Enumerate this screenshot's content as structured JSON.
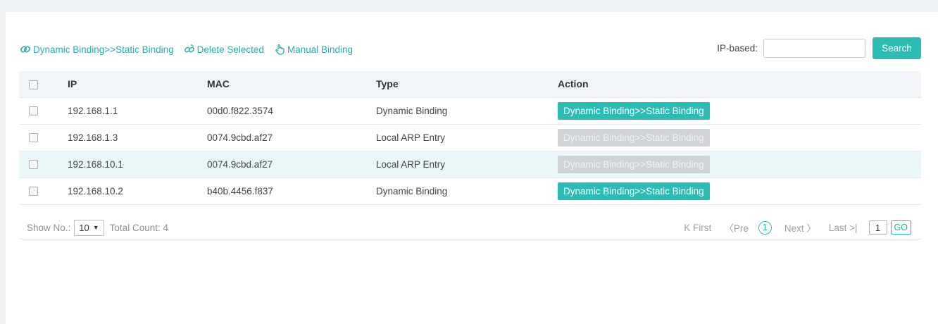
{
  "toolbar": {
    "convert_label": "Dynamic Binding>>Static Binding",
    "delete_label": "Delete Selected",
    "manual_label": "Manual Binding"
  },
  "search": {
    "label": "IP-based:",
    "value": "",
    "button_label": "Search"
  },
  "table": {
    "headers": [
      "IP",
      "MAC",
      "Type",
      "Action"
    ],
    "rows": [
      {
        "ip": "192.168.1.1",
        "mac": "00d0.f822.3574",
        "type": "Dynamic Binding",
        "action": "Dynamic Binding>>Static Binding",
        "action_enabled": true
      },
      {
        "ip": "192.168.1.3",
        "mac": "0074.9cbd.af27",
        "type": "Local ARP Entry",
        "action": "Dynamic Binding>>Static Binding",
        "action_enabled": false
      },
      {
        "ip": "192.168.10.1",
        "mac": "0074.9cbd.af27",
        "type": "Local ARP Entry",
        "action": "Dynamic Binding>>Static Binding",
        "action_enabled": false
      },
      {
        "ip": "192.168.10.2",
        "mac": "b40b.4456.f837",
        "type": "Dynamic Binding",
        "action": "Dynamic Binding>>Static Binding",
        "action_enabled": true
      }
    ]
  },
  "pagination": {
    "show_label": "Show No.:",
    "page_size": "10",
    "total_label": "Total Count: 4",
    "first": "First",
    "prev": "Pre",
    "current_page": "1",
    "next": "Next",
    "last": "Last",
    "goto_value": "1",
    "go_label": "GO"
  },
  "colors": {
    "accent": "#2bbdb3",
    "link": "#2aada4",
    "disabled": "#cfd3d6",
    "row_highlight": "#eaf7f8"
  }
}
